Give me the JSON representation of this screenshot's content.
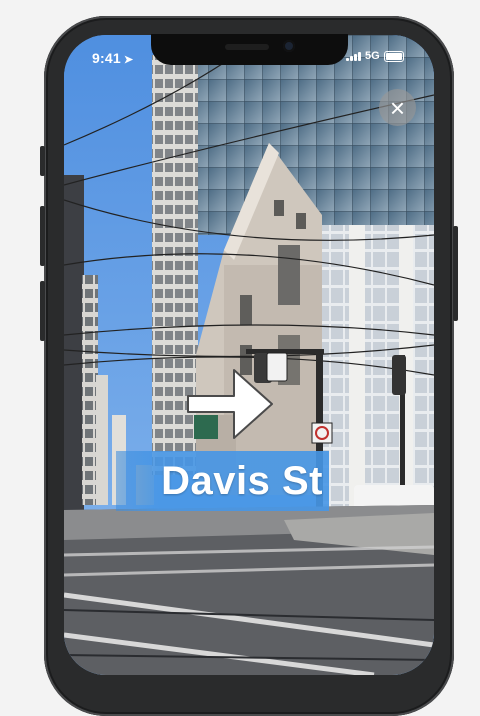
{
  "status_bar": {
    "time": "9:41",
    "network": "5G"
  },
  "navigation": {
    "street_name": "Davis St",
    "turn_direction": "right"
  },
  "controls": {
    "close_glyph": "×"
  },
  "icons": [
    "location-arrow-icon",
    "signal-icon",
    "battery-icon",
    "close-icon",
    "turn-right-arrow-icon"
  ]
}
